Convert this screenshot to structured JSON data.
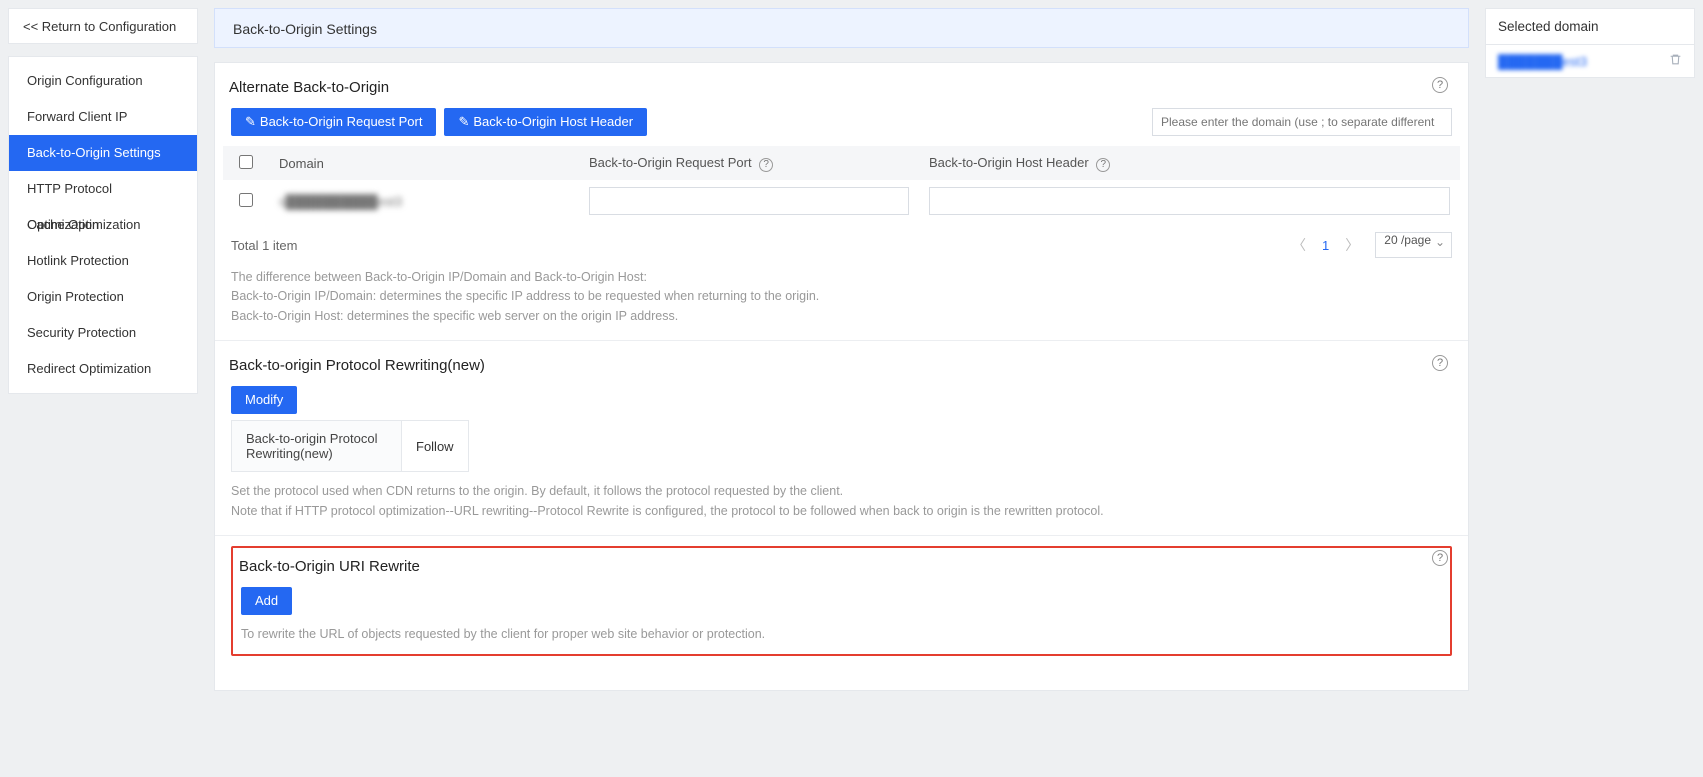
{
  "sidebar": {
    "return_label": "<<  Return to Configuration",
    "items": [
      {
        "label": "Origin Configuration"
      },
      {
        "label": "Forward Client IP"
      },
      {
        "label": "Back-to-Origin Settings",
        "active": true
      },
      {
        "label": "HTTP Protocol Optimization"
      },
      {
        "label": "Cache Optimization"
      },
      {
        "label": "Hotlink Protection"
      },
      {
        "label": "Origin Protection"
      },
      {
        "label": "Security Protection"
      },
      {
        "label": "Redirect Optimization"
      }
    ]
  },
  "main": {
    "title": "Back-to-Origin Settings"
  },
  "alt": {
    "title": "Alternate Back-to-Origin",
    "btn_port": "Back-to-Origin Request Port",
    "btn_host": "Back-to-Origin Host Header",
    "filter_placeholder": "Please enter the domain (use ; to separate different",
    "cols": {
      "domain": "Domain",
      "port": "Back-to-Origin Request Port",
      "host": "Back-to-Origin Host Header"
    },
    "rows": [
      {
        "domain": "s██████████est3"
      }
    ],
    "total_label": "Total 1 item",
    "page_num": "1",
    "page_size": "20 /page",
    "note_line1": "The difference between Back-to-Origin IP/Domain and Back-to-Origin Host:",
    "note_line2": "Back-to-Origin IP/Domain: determines the specific IP address to be requested when returning to the origin.",
    "note_line3": "Back-to-Origin Host: determines the specific web server on the origin IP address."
  },
  "proto": {
    "title": "Back-to-origin Protocol Rewriting(new)",
    "modify_label": "Modify",
    "key_label": "Back-to-origin Protocol Rewriting(new)",
    "value": "Follow",
    "note_line1": "Set the protocol used when CDN returns to the origin. By default, it follows the protocol requested by the client.",
    "note_line2": "Note that if HTTP protocol optimization--URL rewriting--Protocol Rewrite is configured, the protocol to be followed when back to origin is the rewritten protocol."
  },
  "uri": {
    "title": "Back-to-Origin URI Rewrite",
    "add_label": "Add",
    "note": "To rewrite the URL of objects requested by the client for proper web site behavior or protection."
  },
  "right": {
    "header": "Selected domain",
    "domain": "███████est3"
  }
}
